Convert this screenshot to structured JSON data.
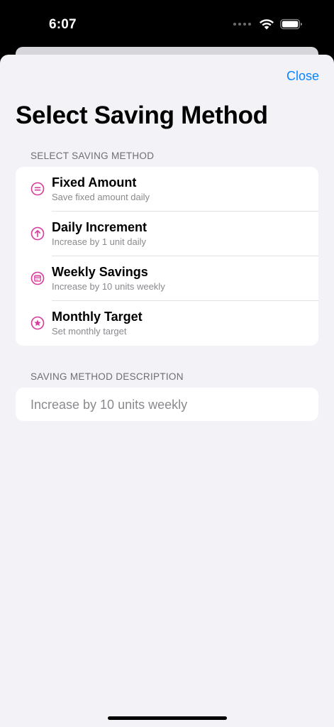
{
  "status_bar": {
    "time": "6:07"
  },
  "header": {
    "close_label": "Close",
    "title": "Select Saving Method"
  },
  "accent_color": "#d63c9c",
  "link_color": "#0a84ff",
  "methods_section": {
    "header": "SELECT SAVING METHOD",
    "items": [
      {
        "icon": "equal-circle-icon",
        "title": "Fixed Amount",
        "subtitle": "Save fixed amount daily"
      },
      {
        "icon": "arrow-up-circle-icon",
        "title": "Daily Increment",
        "subtitle": "Increase by 1 unit daily"
      },
      {
        "icon": "calendar-circle-icon",
        "title": "Weekly Savings",
        "subtitle": "Increase by 10 units weekly"
      },
      {
        "icon": "star-circle-icon",
        "title": "Monthly Target",
        "subtitle": "Set monthly target"
      }
    ]
  },
  "description_section": {
    "header": "SAVING METHOD DESCRIPTION",
    "text": "Increase by 10 units weekly"
  }
}
